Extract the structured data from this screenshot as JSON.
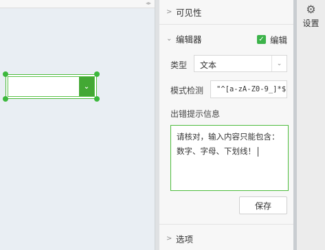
{
  "canvas": {
    "collapse_arrows": "◂▸",
    "widget": {
      "dropdown_icon": "⌄"
    }
  },
  "panel": {
    "visibility_label": "可见性",
    "editor_label": "编辑器",
    "edit_checkbox": {
      "label": "编辑",
      "checked": true
    },
    "type_label": "类型",
    "type_value": "文本",
    "pattern_label": "模式检测",
    "pattern_value": "\"^[a-zA-Z0-9_]*$\"",
    "error_label": "出错提示信息",
    "error_message": "请核对，输入内容只能包含：数字、字母、下划线！",
    "save_label": "保存",
    "options_label": "选项"
  },
  "rail": {
    "settings_label": "设置",
    "settings_icon": "gear-icon"
  },
  "colors": {
    "accent_green": "#3cb34a",
    "widget_button": "#43a834"
  }
}
